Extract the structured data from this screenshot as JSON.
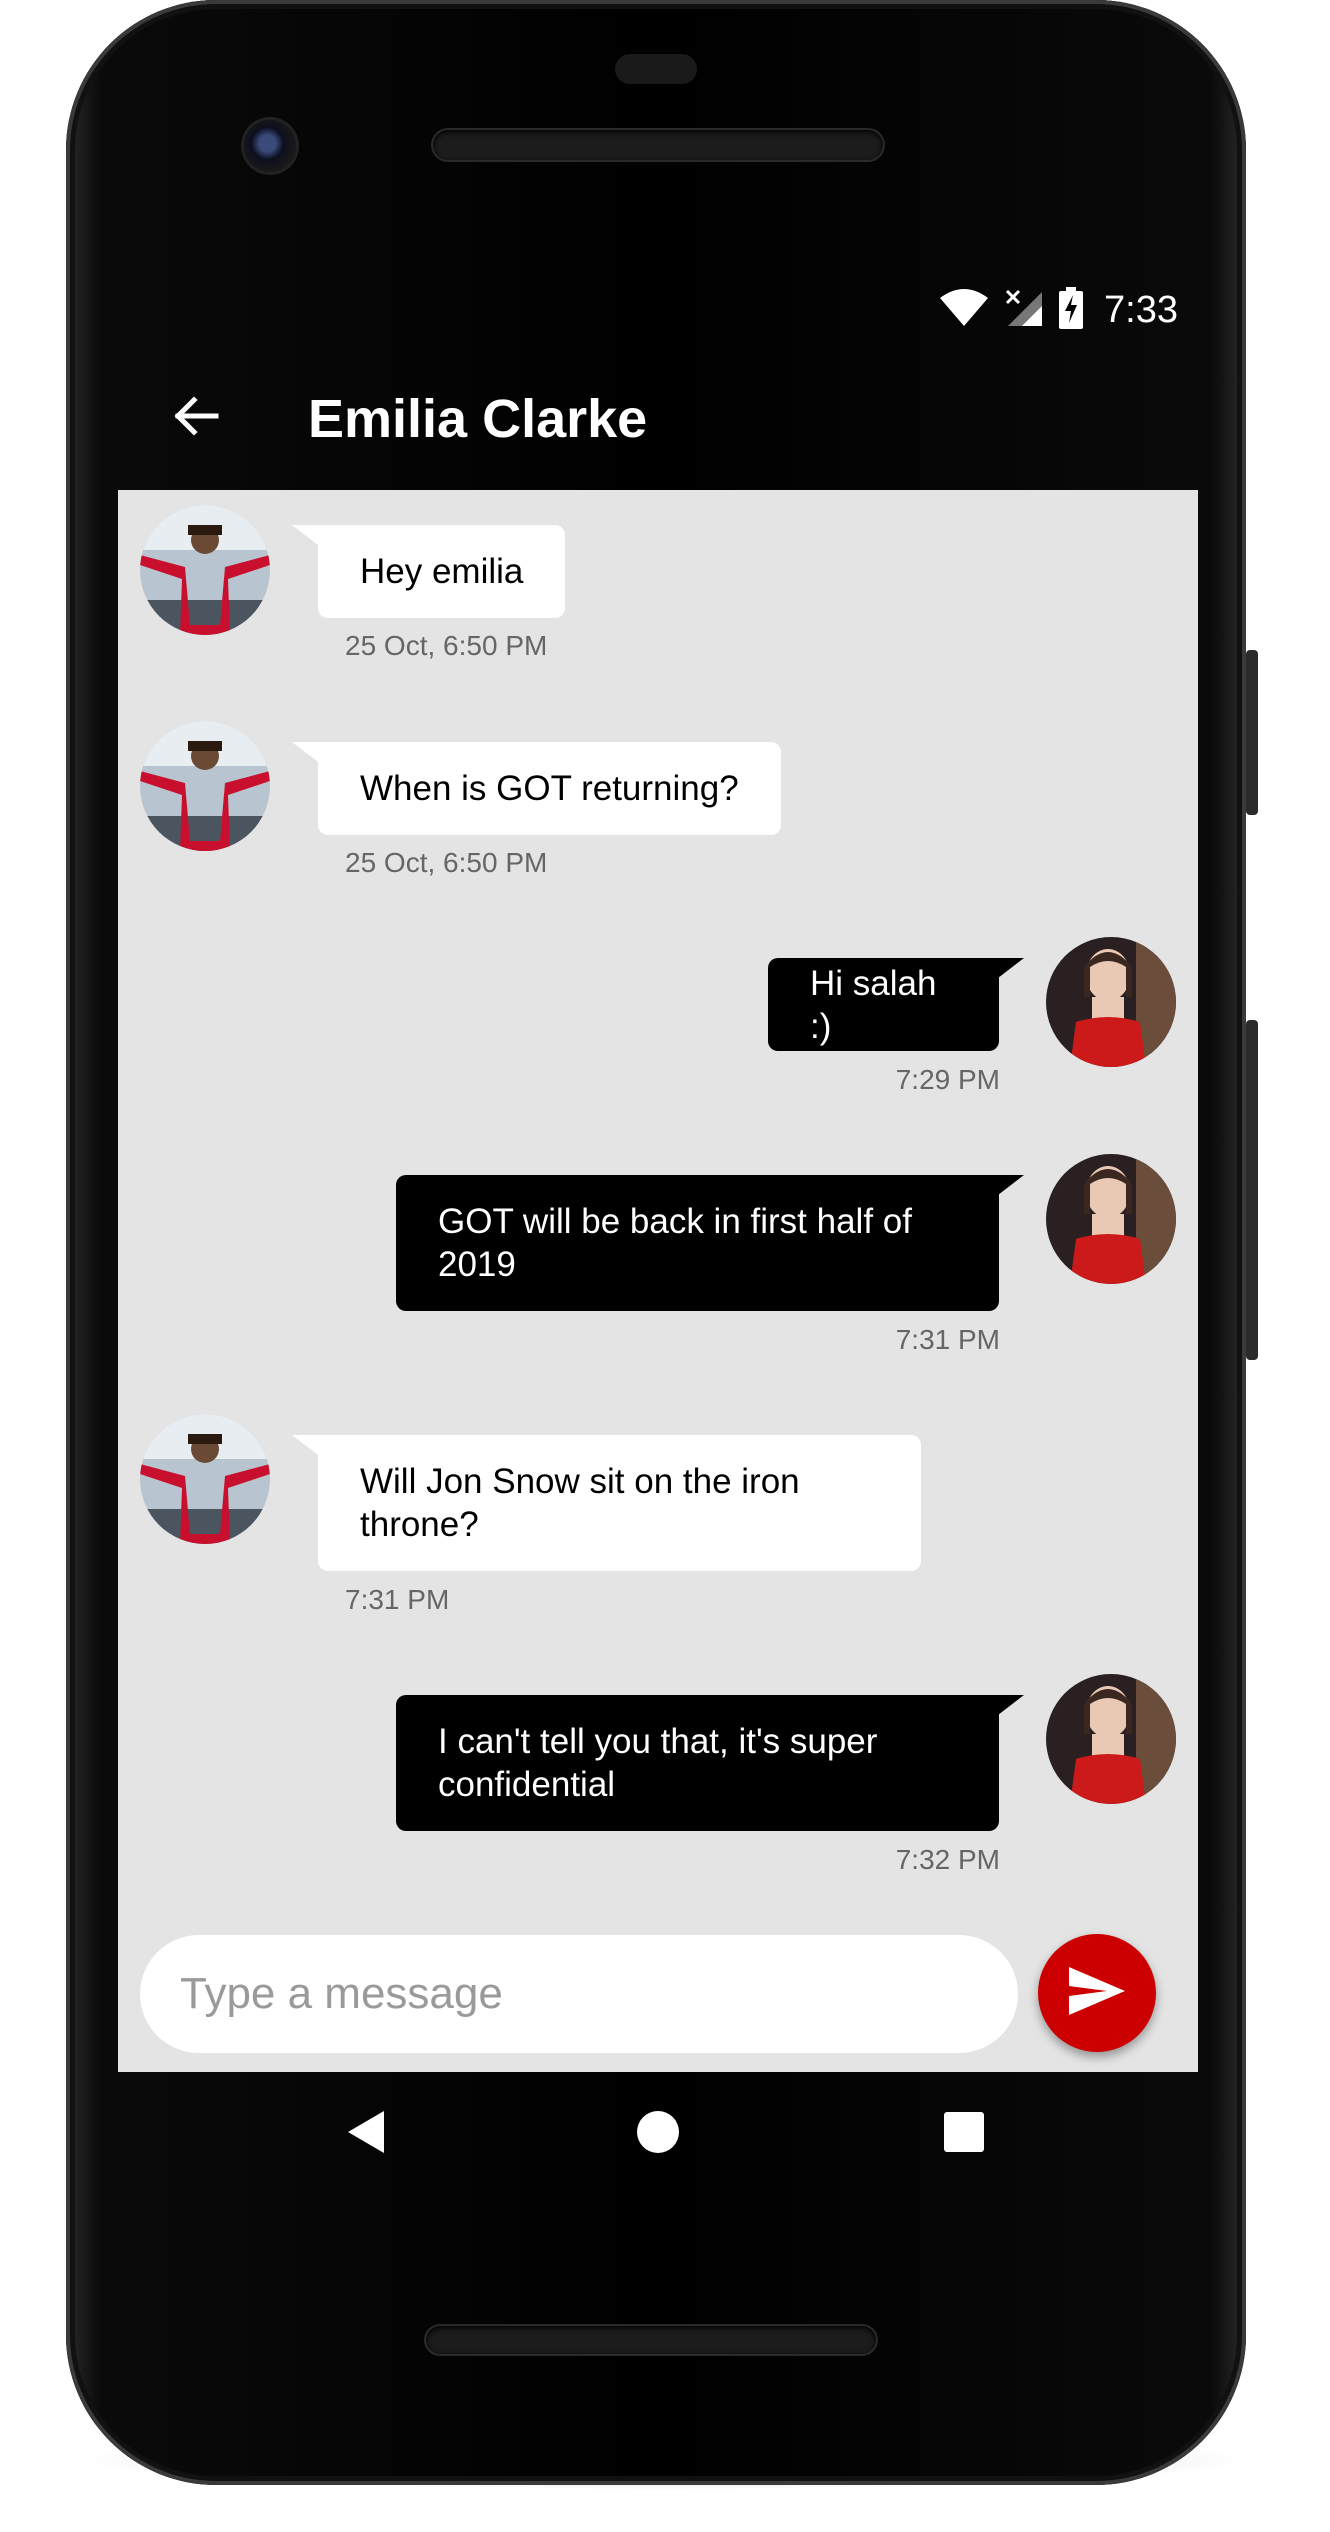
{
  "status_bar": {
    "time": "7:33",
    "icons": [
      "wifi-icon",
      "cellular-no-signal-icon",
      "battery-charging-icon"
    ]
  },
  "app_bar": {
    "back_icon": "arrow-back-icon",
    "title": "Emilia Clarke"
  },
  "messages": [
    {
      "direction": "incoming",
      "text": "Hey emilia",
      "time": "25 Oct, 6:50 PM",
      "avatar": "salah-avatar"
    },
    {
      "direction": "incoming",
      "text": "When is GOT returning?",
      "time": "25 Oct, 6:50 PM",
      "avatar": "salah-avatar"
    },
    {
      "direction": "outgoing",
      "text": "Hi salah :)",
      "time": "7:29 PM",
      "avatar": "emilia-avatar"
    },
    {
      "direction": "outgoing",
      "text": "GOT will be back in first half of 2019",
      "time": "7:31 PM",
      "avatar": "emilia-avatar"
    },
    {
      "direction": "incoming",
      "text": "Will Jon Snow sit on the iron throne?",
      "time": "7:31 PM",
      "avatar": "salah-avatar"
    },
    {
      "direction": "outgoing",
      "text": "I can't tell you that, it's super confidential",
      "time": "7:32 PM",
      "avatar": "emilia-avatar"
    }
  ],
  "composer": {
    "value": "",
    "placeholder": "Type a message",
    "send_icon": "send-icon"
  },
  "colors": {
    "chat_background": "#e4e4e4",
    "incoming_bubble": "#ffffff",
    "outgoing_bubble": "#000000",
    "send_button": "#cc0000",
    "app_bar": "#000000"
  },
  "nav_bar": {
    "icons": [
      "nav-back-icon",
      "nav-home-icon",
      "nav-recents-icon"
    ]
  }
}
